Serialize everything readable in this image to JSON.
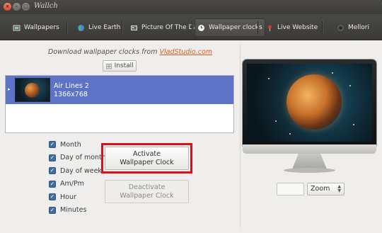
{
  "window": {
    "title": "Wallch"
  },
  "tabs": [
    {
      "label": "Wallpapers",
      "icon": "wallpapers-icon"
    },
    {
      "label": "Live Earth",
      "icon": "earth-icon"
    },
    {
      "label": "Picture Of The Day",
      "icon": "picture-icon"
    },
    {
      "label": "Wallpaper clocks",
      "icon": "clock-icon",
      "active": true
    },
    {
      "label": "Live Website",
      "icon": "pin-icon"
    },
    {
      "label": "Mellori",
      "icon": "mellori-icon"
    }
  ],
  "main": {
    "download_prefix": "Download wallpaper clocks from",
    "download_link": "VladStudio.com",
    "install_label": "Install",
    "clocks": [
      {
        "name": "Air Lines 2",
        "resolution": "1366x768",
        "selected": true
      }
    ],
    "options": [
      {
        "label": "Month",
        "checked": true
      },
      {
        "label": "Day of month",
        "checked": true
      },
      {
        "label": "Day of week",
        "checked": true
      },
      {
        "label": "Am/Pm",
        "checked": true
      },
      {
        "label": "Hour",
        "checked": true
      },
      {
        "label": "Minutes",
        "checked": true
      }
    ],
    "activate_label_line1": "Activate",
    "activate_label_line2": "Wallpaper Clock",
    "deactivate_label_line1": "Deactivate",
    "deactivate_label_line2": "Wallpaper Clock"
  },
  "preview": {
    "zoom_value": "Zoom"
  },
  "colors": {
    "accent": "#5d73c8",
    "highlight": "#d4121b",
    "link": "#e05a18",
    "titlebar": "#3c3b37"
  }
}
